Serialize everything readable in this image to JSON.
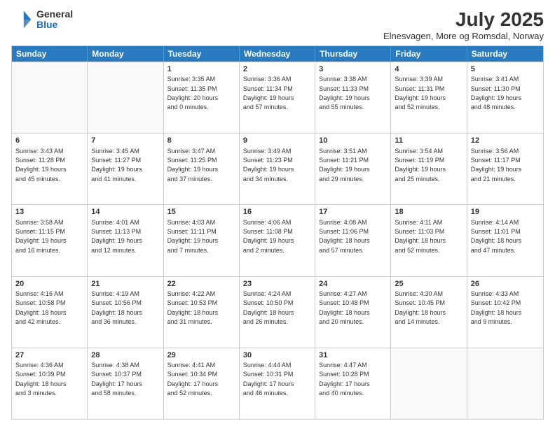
{
  "logo": {
    "general": "General",
    "blue": "Blue"
  },
  "title": {
    "month": "July 2025",
    "location": "Elnesvagen, More og Romsdal, Norway"
  },
  "header": {
    "days": [
      "Sunday",
      "Monday",
      "Tuesday",
      "Wednesday",
      "Thursday",
      "Friday",
      "Saturday"
    ]
  },
  "weeks": [
    [
      {
        "day": "",
        "info": ""
      },
      {
        "day": "",
        "info": ""
      },
      {
        "day": "1",
        "info": "Sunrise: 3:35 AM\nSunset: 11:35 PM\nDaylight: 20 hours\nand 0 minutes."
      },
      {
        "day": "2",
        "info": "Sunrise: 3:36 AM\nSunset: 11:34 PM\nDaylight: 19 hours\nand 57 minutes."
      },
      {
        "day": "3",
        "info": "Sunrise: 3:38 AM\nSunset: 11:33 PM\nDaylight: 19 hours\nand 55 minutes."
      },
      {
        "day": "4",
        "info": "Sunrise: 3:39 AM\nSunset: 11:31 PM\nDaylight: 19 hours\nand 52 minutes."
      },
      {
        "day": "5",
        "info": "Sunrise: 3:41 AM\nSunset: 11:30 PM\nDaylight: 19 hours\nand 48 minutes."
      }
    ],
    [
      {
        "day": "6",
        "info": "Sunrise: 3:43 AM\nSunset: 11:28 PM\nDaylight: 19 hours\nand 45 minutes."
      },
      {
        "day": "7",
        "info": "Sunrise: 3:45 AM\nSunset: 11:27 PM\nDaylight: 19 hours\nand 41 minutes."
      },
      {
        "day": "8",
        "info": "Sunrise: 3:47 AM\nSunset: 11:25 PM\nDaylight: 19 hours\nand 37 minutes."
      },
      {
        "day": "9",
        "info": "Sunrise: 3:49 AM\nSunset: 11:23 PM\nDaylight: 19 hours\nand 34 minutes."
      },
      {
        "day": "10",
        "info": "Sunrise: 3:51 AM\nSunset: 11:21 PM\nDaylight: 19 hours\nand 29 minutes."
      },
      {
        "day": "11",
        "info": "Sunrise: 3:54 AM\nSunset: 11:19 PM\nDaylight: 19 hours\nand 25 minutes."
      },
      {
        "day": "12",
        "info": "Sunrise: 3:56 AM\nSunset: 11:17 PM\nDaylight: 19 hours\nand 21 minutes."
      }
    ],
    [
      {
        "day": "13",
        "info": "Sunrise: 3:58 AM\nSunset: 11:15 PM\nDaylight: 19 hours\nand 16 minutes."
      },
      {
        "day": "14",
        "info": "Sunrise: 4:01 AM\nSunset: 11:13 PM\nDaylight: 19 hours\nand 12 minutes."
      },
      {
        "day": "15",
        "info": "Sunrise: 4:03 AM\nSunset: 11:11 PM\nDaylight: 19 hours\nand 7 minutes."
      },
      {
        "day": "16",
        "info": "Sunrise: 4:06 AM\nSunset: 11:08 PM\nDaylight: 19 hours\nand 2 minutes."
      },
      {
        "day": "17",
        "info": "Sunrise: 4:08 AM\nSunset: 11:06 PM\nDaylight: 18 hours\nand 57 minutes."
      },
      {
        "day": "18",
        "info": "Sunrise: 4:11 AM\nSunset: 11:03 PM\nDaylight: 18 hours\nand 52 minutes."
      },
      {
        "day": "19",
        "info": "Sunrise: 4:14 AM\nSunset: 11:01 PM\nDaylight: 18 hours\nand 47 minutes."
      }
    ],
    [
      {
        "day": "20",
        "info": "Sunrise: 4:16 AM\nSunset: 10:58 PM\nDaylight: 18 hours\nand 42 minutes."
      },
      {
        "day": "21",
        "info": "Sunrise: 4:19 AM\nSunset: 10:56 PM\nDaylight: 18 hours\nand 36 minutes."
      },
      {
        "day": "22",
        "info": "Sunrise: 4:22 AM\nSunset: 10:53 PM\nDaylight: 18 hours\nand 31 minutes."
      },
      {
        "day": "23",
        "info": "Sunrise: 4:24 AM\nSunset: 10:50 PM\nDaylight: 18 hours\nand 26 minutes."
      },
      {
        "day": "24",
        "info": "Sunrise: 4:27 AM\nSunset: 10:48 PM\nDaylight: 18 hours\nand 20 minutes."
      },
      {
        "day": "25",
        "info": "Sunrise: 4:30 AM\nSunset: 10:45 PM\nDaylight: 18 hours\nand 14 minutes."
      },
      {
        "day": "26",
        "info": "Sunrise: 4:33 AM\nSunset: 10:42 PM\nDaylight: 18 hours\nand 9 minutes."
      }
    ],
    [
      {
        "day": "27",
        "info": "Sunrise: 4:36 AM\nSunset: 10:39 PM\nDaylight: 18 hours\nand 3 minutes."
      },
      {
        "day": "28",
        "info": "Sunrise: 4:38 AM\nSunset: 10:37 PM\nDaylight: 17 hours\nand 58 minutes."
      },
      {
        "day": "29",
        "info": "Sunrise: 4:41 AM\nSunset: 10:34 PM\nDaylight: 17 hours\nand 52 minutes."
      },
      {
        "day": "30",
        "info": "Sunrise: 4:44 AM\nSunset: 10:31 PM\nDaylight: 17 hours\nand 46 minutes."
      },
      {
        "day": "31",
        "info": "Sunrise: 4:47 AM\nSunset: 10:28 PM\nDaylight: 17 hours\nand 40 minutes."
      },
      {
        "day": "",
        "info": ""
      },
      {
        "day": "",
        "info": ""
      }
    ]
  ]
}
